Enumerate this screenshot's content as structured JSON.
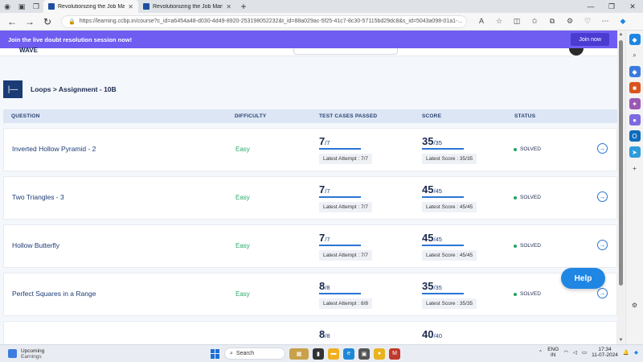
{
  "browser": {
    "tabs": [
      {
        "label": "Revolutionizing the Job Market |",
        "active": true
      },
      {
        "label": "Revolutionizing the Job Market |",
        "active": false
      }
    ],
    "url": "https://learning.ccbp.in/course?c_id=a6454a48-d030-4d49-8920-253198052232&t_id=88a029ac-5f25-41c7-8c30-57115bd29dc8&s_id=5043a098-01a1-..."
  },
  "banner": {
    "text": "Join the live doubt resolution session now!",
    "button": "Join now"
  },
  "header": {
    "logo_text": "WAVE"
  },
  "breadcrumb": {
    "toggle": "|—",
    "text": "Loops > Assignment - 10B"
  },
  "table": {
    "headers": {
      "question": "QUESTION",
      "difficulty": "DIFFICULTY",
      "tests": "TEST CASES PASSED",
      "score": "SCORE",
      "status": "STATUS"
    },
    "rows": [
      {
        "question": "Inverted Hollow Pyramid - 2",
        "difficulty": "Easy",
        "tests_big": "7",
        "tests_small": "/7",
        "attempt": "Latest Attempt : 7/7",
        "score_big": "35",
        "score_small": "/35",
        "latest_score": "Latest Score : 35/35",
        "status": "SOLVED"
      },
      {
        "question": "Two Triangles - 3",
        "difficulty": "Easy",
        "tests_big": "7",
        "tests_small": "/7",
        "attempt": "Latest Attempt : 7/7",
        "score_big": "45",
        "score_small": "/45",
        "latest_score": "Latest Score : 45/45",
        "status": "SOLVED"
      },
      {
        "question": "Hollow Butterfly",
        "difficulty": "Easy",
        "tests_big": "7",
        "tests_small": "/7",
        "attempt": "Latest Attempt : 7/7",
        "score_big": "45",
        "score_small": "/45",
        "latest_score": "Latest Score : 45/45",
        "status": "SOLVED"
      },
      {
        "question": "Perfect Squares in a Range",
        "difficulty": "Easy",
        "tests_big": "8",
        "tests_small": "/8",
        "attempt": "Latest Attempt : 8/8",
        "score_big": "35",
        "score_small": "/35",
        "latest_score": "Latest Score : 35/35",
        "status": "SOLVED"
      },
      {
        "question": "",
        "difficulty": "",
        "tests_big": "8",
        "tests_small": "/8",
        "attempt": "",
        "score_big": "40",
        "score_small": "/40",
        "latest_score": "",
        "status": ""
      }
    ]
  },
  "help_button": "Help",
  "taskbar": {
    "weather_title": "Upcoming",
    "weather_sub": "Earnings",
    "search": "Search",
    "lang_top": "ENG",
    "lang_bottom": "IN",
    "time": "17:34",
    "date": "11-07-2024"
  },
  "colors": {
    "banner": "#6f5cf1",
    "primary_blue": "#1b3b75",
    "accent_blue": "#2a76d4",
    "easy_green": "#2fa96e",
    "help": "#1f86e4"
  }
}
